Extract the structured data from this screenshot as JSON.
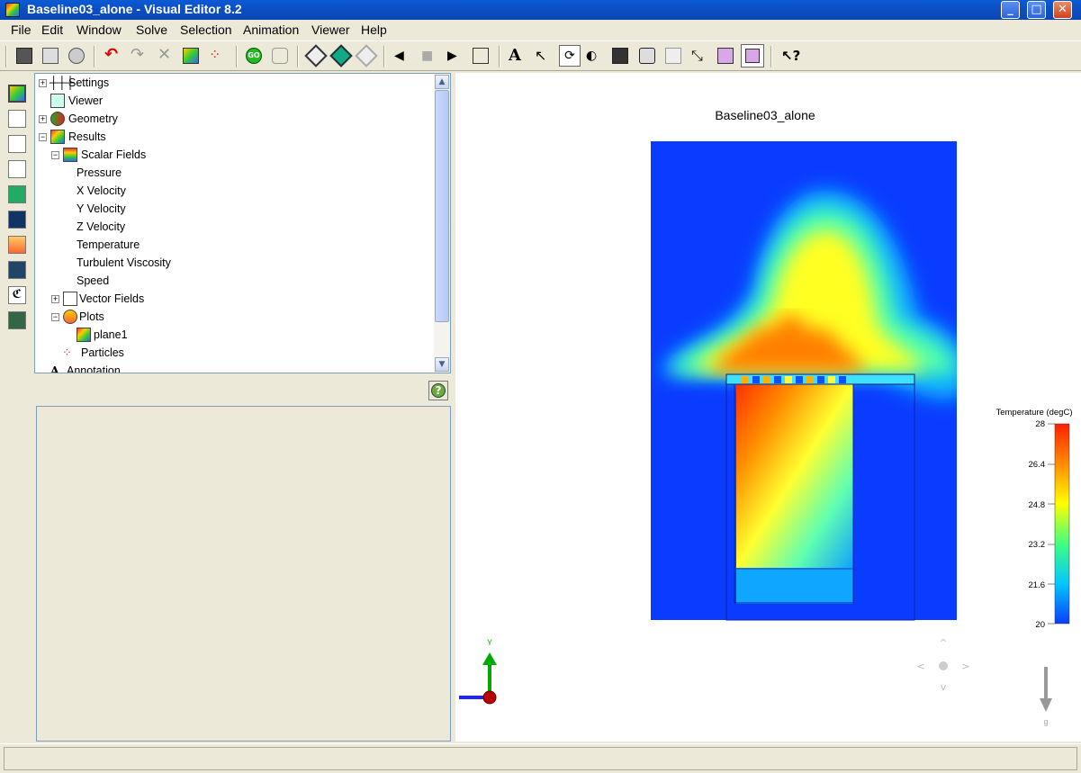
{
  "window": {
    "title": "Baseline03_alone - Visual Editor 8.2"
  },
  "menu": [
    "File",
    "Edit",
    "Window",
    "Solve",
    "Selection",
    "Animation",
    "Viewer",
    "Help"
  ],
  "tree": {
    "settings": "Settings",
    "viewer": "Viewer",
    "geometry": "Geometry",
    "results": "Results",
    "scalar_fields": "Scalar Fields",
    "pressure": "Pressure",
    "x_velocity": "X Velocity",
    "y_velocity": "Y Velocity",
    "z_velocity": "Z Velocity",
    "temperature": "Temperature",
    "turbulent_viscosity": "Turbulent Viscosity",
    "speed": "Speed",
    "vector_fields": "Vector Fields",
    "plots": "Plots",
    "plane1": "plane1",
    "particles": "Particles",
    "annotation": "Annotation"
  },
  "viewer": {
    "plot_title": "Baseline03_alone",
    "legend_title": "Temperature (degC)",
    "legend_ticks": [
      "28",
      "26.4",
      "24.8",
      "23.2",
      "21.6",
      "20"
    ],
    "axis_y_label": "Y",
    "gravity_label": "g",
    "colors": {
      "cold": "#0a3cff",
      "hot": "#ff2a00",
      "mid": "#ffff00"
    }
  }
}
